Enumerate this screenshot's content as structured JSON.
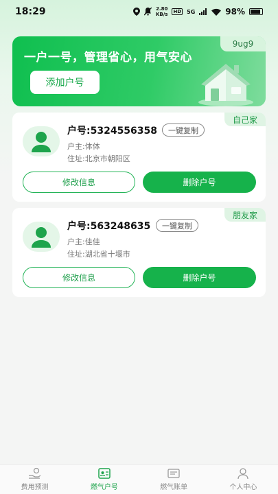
{
  "status_bar": {
    "time": "18:29",
    "speed_value": "2.80",
    "speed_unit": "KB/s",
    "hd_label": "HD",
    "network": "5G",
    "battery": "98%"
  },
  "banner": {
    "tag": "9ug9",
    "slogan": "一户一号，管理省心，用气安心",
    "add_button": "添加户号"
  },
  "accounts": [
    {
      "tag": "自己家",
      "account_label": "户号:5324556358",
      "copy_label": "一键复制",
      "owner": "户主:体体",
      "address": "住址:北京市朝阳区",
      "edit_label": "修改信息",
      "delete_label": "删除户号"
    },
    {
      "tag": "朋友家",
      "account_label": "户号:563248635",
      "copy_label": "一键复制",
      "owner": "户主:佳佳",
      "address": "住址:湖北省十堰市",
      "edit_label": "修改信息",
      "delete_label": "删除户号"
    }
  ],
  "tabs": [
    {
      "label": "费用预测",
      "icon": "hand-coin-icon",
      "active": false
    },
    {
      "label": "燃气户号",
      "icon": "id-card-icon",
      "active": true
    },
    {
      "label": "燃气账单",
      "icon": "bill-icon",
      "active": false
    },
    {
      "label": "个人中心",
      "icon": "person-icon",
      "active": false
    }
  ],
  "colors": {
    "accent": "#16b24b",
    "tag_bg": "#dff4e4"
  }
}
